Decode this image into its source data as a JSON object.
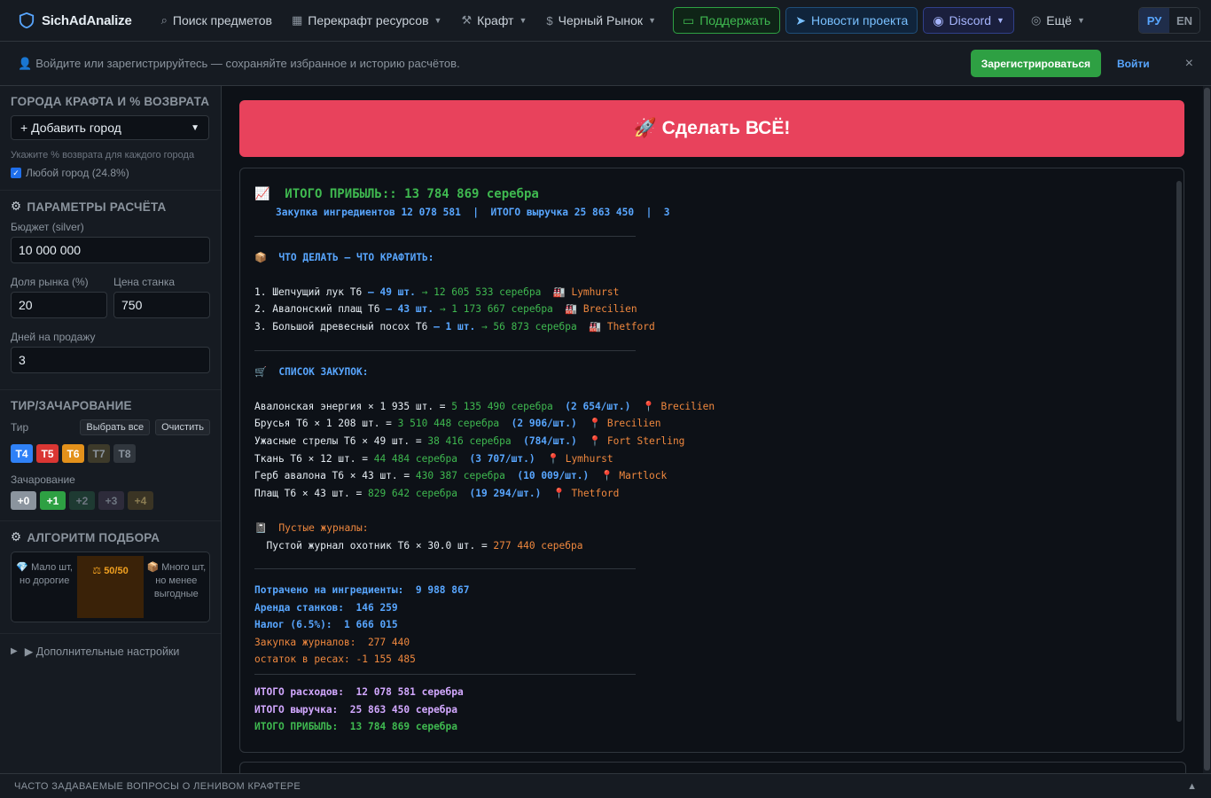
{
  "nav": {
    "brand": "SichAdAnalize",
    "items": [
      {
        "label": "Поиск предметов",
        "icon": "search-icon",
        "dropdown": false
      },
      {
        "label": "Перекрафт ресурсов",
        "icon": "grid-icon",
        "dropdown": true
      },
      {
        "label": "Крафт",
        "icon": "hammer-icon",
        "dropdown": true
      },
      {
        "label": "Черный Рынок",
        "icon": "dollar-icon",
        "dropdown": true
      }
    ],
    "support": "Поддержать",
    "news": "Новости проекта",
    "discord": "Discord",
    "more": "Ещё",
    "lang_ru": "РУ",
    "lang_en": "EN"
  },
  "banner": {
    "text": "Войдите или зарегистрируйтесь — сохраняйте избранное и историю расчётов.",
    "register": "Зарегистрироваться",
    "login": "Войти",
    "close": "×"
  },
  "sidebar": {
    "cities_title": "ГОРОДА КРАФТА И % ВОЗВРАТА",
    "add_city": "+ Добавить город",
    "cities_hint": "Укажите % возврата для каждого города",
    "any_city": "Любой город",
    "any_city_pct": "(24.8%)",
    "params_title": "ПАРАМЕТРЫ РАСЧЁТА",
    "budget_label": "Бюджет (silver)",
    "budget_value": "10 000 000",
    "market_label": "Доля рынка (%)",
    "market_value": "20",
    "station_label": "Цена станка",
    "station_value": "750",
    "days_label": "Дней на продажу",
    "days_value": "3",
    "tier_title": "ТИР/ЗАЧАРОВАНИЕ",
    "tier_label": "Тир",
    "select_all": "Выбрать все",
    "clear": "Очистить",
    "tiers": [
      {
        "label": "T4",
        "bg": "#2f81f7",
        "fg": "#ffffff"
      },
      {
        "label": "T5",
        "bg": "#da3633",
        "fg": "#ffffff"
      },
      {
        "label": "T6",
        "bg": "#e3911b",
        "fg": "#ffffff"
      },
      {
        "label": "T7",
        "bg": "#3d3a2a",
        "fg": "#8b949e"
      },
      {
        "label": "T8",
        "bg": "#30363d",
        "fg": "#8b949e"
      }
    ],
    "ench_label": "Зачарование",
    "enchants": [
      {
        "label": "+0",
        "bg": "#8b949e",
        "fg": "#ffffff"
      },
      {
        "label": "+1",
        "bg": "#2ea043",
        "fg": "#ffffff"
      },
      {
        "label": "+2",
        "bg": "#1e3a32",
        "fg": "#6e7681"
      },
      {
        "label": "+3",
        "bg": "#2d2b3a",
        "fg": "#6e7681"
      },
      {
        "label": "+4",
        "bg": "#3a3424",
        "fg": "#8b7d52"
      }
    ],
    "algo_title": "АЛГОРИТМ ПОДБОРА",
    "algo_options": [
      {
        "icon": "💎",
        "label": "Мало шт, но дорогие",
        "active": false
      },
      {
        "icon": "⚖",
        "label": "50/50",
        "active": true
      },
      {
        "icon": "📦",
        "label": "Много шт, но менее выгодные",
        "active": false
      }
    ],
    "advanced": "▶ Дополнительные настройки"
  },
  "main": {
    "do_all": "🚀 Сделать ВСЁ!"
  },
  "report": {
    "header_title": "📈  ИТОГО ПРИБЫЛЬ:: 13 784 869 серебра",
    "header_sub": "Закупка ингредиентов 12 078 581  |  ИТОГО выручка 25 863 450  |  3",
    "craft_title": "📦  ЧТО ДЕЛАТЬ — ЧТО КРАФТИТЬ:",
    "craft_items": [
      {
        "name": "1. Шепчущий лук T6",
        "qty": " — 49 шт.",
        "value": " → 12 605 533 серебра",
        "city": "  🏭 Lymhurst"
      },
      {
        "name": "2. Авалонский плащ T6",
        "qty": " — 43 шт.",
        "value": " → 1 173 667 серебра",
        "city": "  🏭 Brecilien"
      },
      {
        "name": "3. Большой древесный посох T6",
        "qty": " — 1 шт.",
        "value": " → 56 873 серебра",
        "city": "  🏭 Thetford"
      }
    ],
    "buy_title": "🛒  СПИСОК ЗАКУПОК:",
    "buy_items": [
      {
        "name": "Авалонская энергия × 1 935 шт. = ",
        "value": "5 135 490 серебра",
        "unit": "  (2 654/шт.)",
        "city": "  📍 Brecilien"
      },
      {
        "name": "Брусья T6 × 1 208 шт. = ",
        "value": "3 510 448 серебра",
        "unit": "  (2 906/шт.)",
        "city": "  📍 Brecilien"
      },
      {
        "name": "Ужасные стрелы T6 × 49 шт. = ",
        "value": "38 416 серебра",
        "unit": "  (784/шт.)",
        "city": "  📍 Fort Sterling"
      },
      {
        "name": "Ткань T6 × 12 шт. = ",
        "value": "44 484 серебра",
        "unit": "  (3 707/шт.)",
        "city": "  📍 Lymhurst"
      },
      {
        "name": "Герб авалона T6 × 43 шт. = ",
        "value": "430 387 серебра",
        "unit": "  (10 009/шт.)",
        "city": "  📍 Martlock"
      },
      {
        "name": "Плащ T6 × 43 шт. = ",
        "value": "829 642 серебра",
        "unit": "  (19 294/шт.)",
        "city": "  📍 Thetford"
      }
    ],
    "journals_title": "📓  Пустые журналы:",
    "journals_line_a": "  Пустой журнал охотник T6 × 30.0 шт. = ",
    "journals_line_b": "277 440 серебра",
    "sum_spent": "Потрачено на ингредиенты:  9 988 867",
    "sum_rent": "Аренда станков:  146 259",
    "sum_tax": "Налог (6.5%):  1 666 015",
    "sum_journals": "Закупка журналов:  277 440",
    "sum_rest": "остаток в ресах: -1 155 485",
    "total_expense": "ИТОГО расходов:  12 078 581 серебра",
    "total_revenue": "ИТОГО выручка:  25 863 450 серебра",
    "total_profit": "ИТОГО ПРИБЫЛЬ:  13 784 869 серебра"
  },
  "footer": {
    "text": "ЧАСТО ЗАДАВАЕМЫЕ ВОПРОСЫ О ЛЕНИВОМ КРАФТЕРЕ",
    "arrow": "▲"
  },
  "colors": {
    "accent": "#e8425c",
    "green": "#3fb950",
    "blue": "#58a6ff",
    "orange": "#f0883e"
  }
}
